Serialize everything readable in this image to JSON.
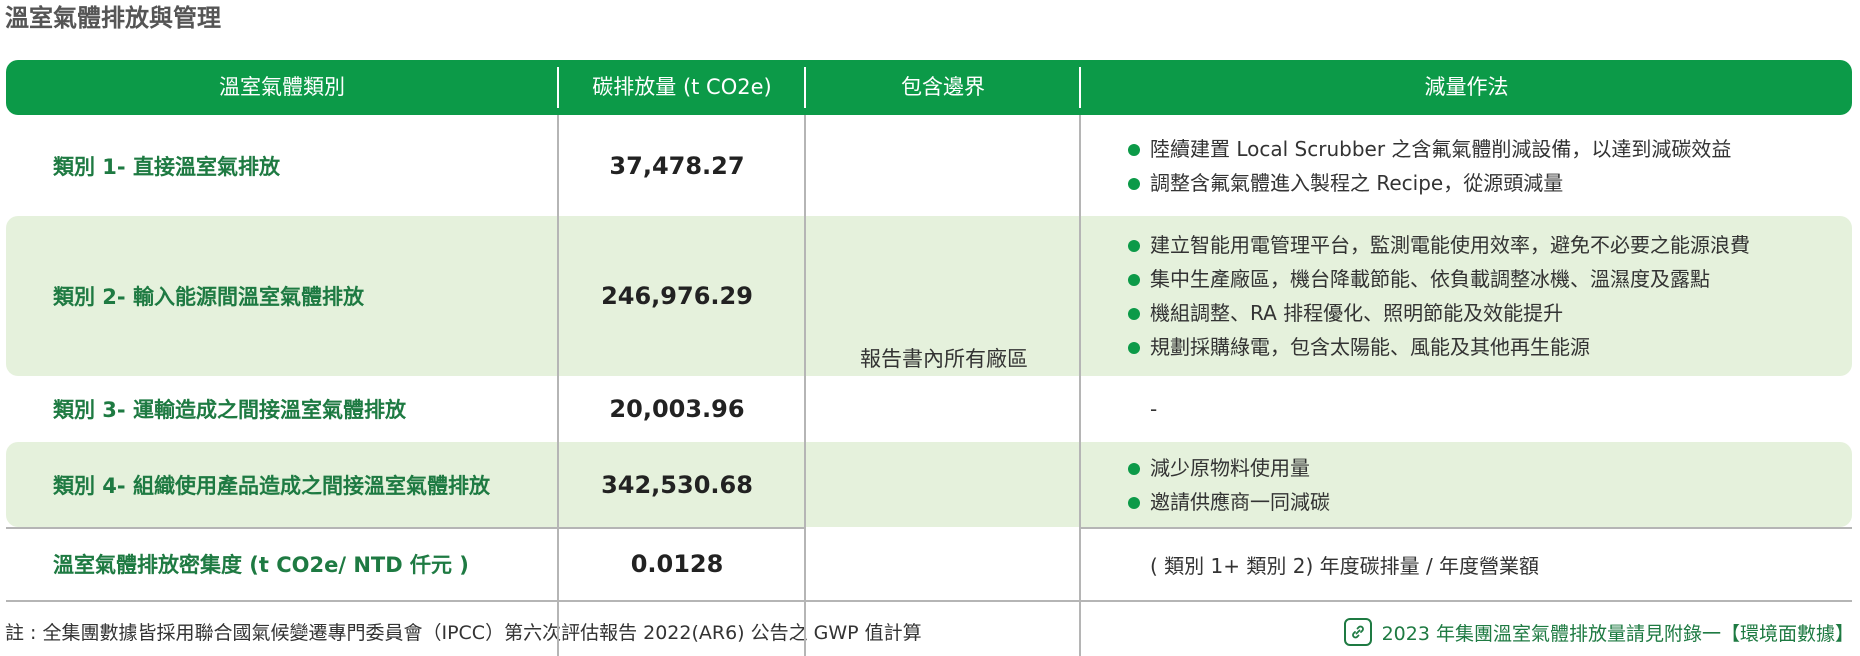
{
  "title": "溫室氣體排放與管理",
  "header": {
    "col1": "溫室氣體類別",
    "col2": "碳排放量 (t CO2e)",
    "col3": "包含邊界",
    "col4": "減量作法"
  },
  "rows": [
    {
      "category": "類別 1- 直接溫室氣排放",
      "emission": "37,478.27",
      "methods": [
        "陸續建置 Local Scrubber 之含氟氣體削減設備，以達到減碳效益",
        "調整含氟氣體進入製程之 Recipe，從源頭減量"
      ]
    },
    {
      "category": "類別 2- 輸入能源間溫室氣體排放",
      "emission": "246,976.29",
      "methods": [
        "建立智能用電管理平台，監測電能使用效率，避免不必要之能源浪費",
        "集中生產廠區，機台降載節能、依負載調整冰機、溫濕度及露點",
        "機組調整、RA 排程優化、照明節能及效能提升",
        "規劃採購綠電，包含太陽能、風能及其他再生能源"
      ]
    },
    {
      "category": "類別 3- 運輸造成之間接溫室氣體排放",
      "emission": "20,003.96",
      "method_text": "-"
    },
    {
      "category": "類別 4- 組織使用產品造成之間接溫室氣體排放",
      "emission": "342,530.68",
      "methods": [
        "減少原物料使用量",
        "邀請供應商一同減碳"
      ]
    },
    {
      "category": "溫室氣體排放密集度 (t CO2e/ NTD 仟元 )",
      "emission": "0.0128",
      "method_text": "( 類別 1+ 類別 2) 年度碳排量 / 年度營業額"
    }
  ],
  "boundary": "報告書內所有廠區",
  "footnote": "註 : 全集團數據皆採用聯合國氣候變遷專門委員會（IPCC）第六次評估報告 2022(AR6) 公告之 GWP 值計算",
  "reference": "2023 年集團溫室氣體排放量請見附錄一【環境面數據】",
  "colors": {
    "accent": "#0c9a48",
    "shade": "#e5f1dc",
    "category_text": "#1e7a42"
  },
  "icons": {
    "reference": "link-icon",
    "bullet": "bullet-dot"
  }
}
